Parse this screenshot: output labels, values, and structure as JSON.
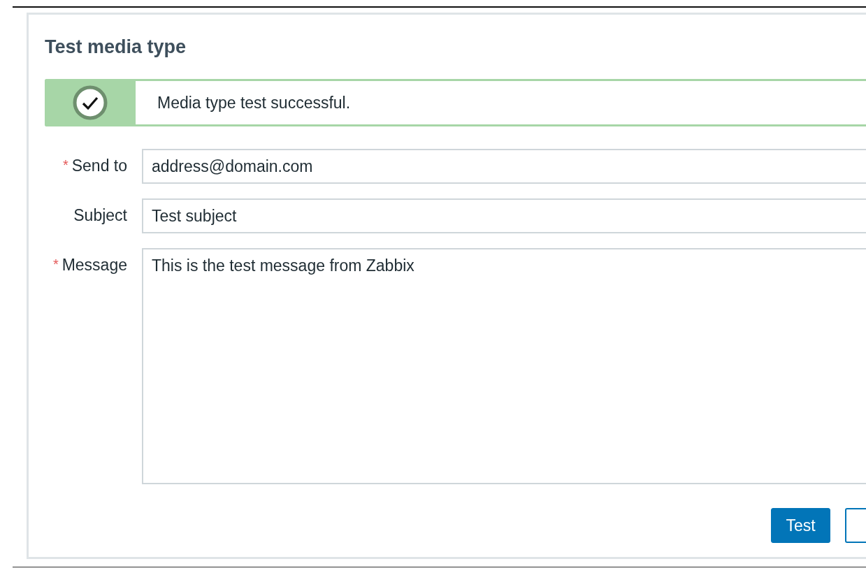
{
  "dialog": {
    "title": "Test media type"
  },
  "message": {
    "kind": "success",
    "text": "Media type test successful."
  },
  "fields": [
    {
      "label": "Send to",
      "required_mark": "*",
      "kind": "input",
      "value": "address@domain.com"
    },
    {
      "label": "Subject",
      "kind": "input",
      "value": "Test subject"
    },
    {
      "label": "Message",
      "required_mark": "*",
      "kind": "textarea",
      "value": "This is the test message from Zabbix"
    }
  ],
  "buttons": [
    {
      "label": "Test",
      "kind": "primary"
    },
    {
      "kind": "secondary"
    }
  ]
}
